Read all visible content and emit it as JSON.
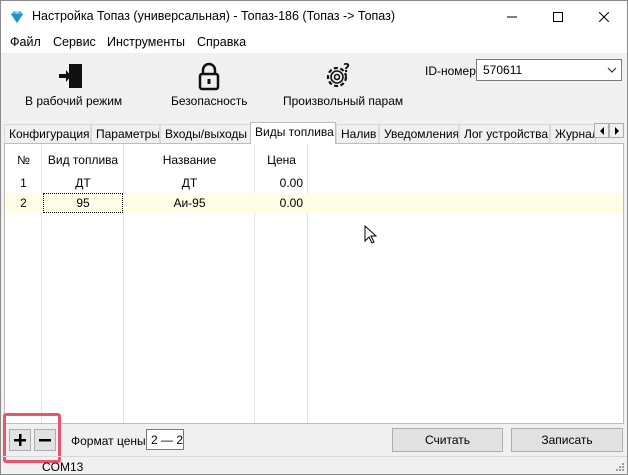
{
  "window": {
    "title": "Настройка Топаз (универсальная) - Топаз-186 (Топаз -> Топаз)"
  },
  "menu": [
    "Файл",
    "Сервис",
    "Инструменты",
    "Справка"
  ],
  "toolbar": {
    "work_mode": "В рабочий режим",
    "security": "Безопасность",
    "custom_param": "Произвольный парам"
  },
  "id_field": {
    "label": "ID-номер",
    "value": "570611"
  },
  "tabs": [
    "Конфигурация",
    "Параметры",
    "Входы/выходы",
    "Виды топлива",
    "Налив",
    "Уведомления",
    "Лог устройства",
    "Журнал"
  ],
  "active_tab": "Виды топлива",
  "grid": {
    "columns": [
      "№",
      "Вид топлива",
      "Название",
      "Цена"
    ],
    "rows": [
      [
        "1",
        "ДТ",
        "ДТ",
        "0.00"
      ],
      [
        "2",
        "95",
        "Аи-95",
        "0.00"
      ]
    ],
    "selected_row": 2
  },
  "bottom": {
    "add": "+",
    "remove": "−",
    "price_format_label": "Формат цены",
    "price_format_value": "2 — 2",
    "read_button": "Считать",
    "write_button": "Записать"
  },
  "status": {
    "port": "COM13"
  },
  "colors": {
    "selection_row": "#fffde6",
    "highlight_border": "#e8556c"
  }
}
